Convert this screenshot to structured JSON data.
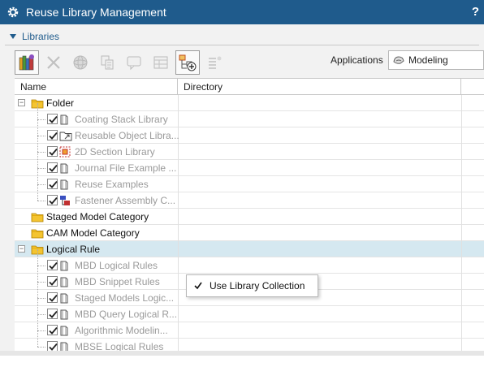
{
  "window": {
    "title": "Reuse Library Management",
    "help_label": "?"
  },
  "section": {
    "title": "Libraries"
  },
  "toolbar": {
    "buttons": [
      {
        "name": "library-books-icon",
        "state": "enabled"
      },
      {
        "name": "delete-x-icon",
        "state": "disabled"
      },
      {
        "name": "model-sphere-icon",
        "state": "disabled"
      },
      {
        "name": "copy-documents-icon",
        "state": "disabled"
      },
      {
        "name": "chat-bubble-icon",
        "state": "disabled"
      },
      {
        "name": "window-layout-icon",
        "state": "disabled"
      },
      {
        "name": "add-collection-icon",
        "state": "enabled"
      },
      {
        "name": "settings-list-icon",
        "state": "disabled"
      }
    ]
  },
  "applications": {
    "label": "Applications",
    "selected": "Modeling"
  },
  "table": {
    "columns": [
      "Name",
      "Directory"
    ]
  },
  "rows": [
    {
      "label": "Folder",
      "level": 0,
      "kind": "folder",
      "expanded": true,
      "checked": false
    },
    {
      "label": "Coating Stack Library",
      "level": 1,
      "kind": "book",
      "checked": true
    },
    {
      "label": "Reusable Object Libra...",
      "level": 1,
      "kind": "folder-arrow",
      "checked": true
    },
    {
      "label": "2D Section Library",
      "level": 1,
      "kind": "section",
      "checked": true
    },
    {
      "label": "Journal File Example ...",
      "level": 1,
      "kind": "book",
      "checked": true
    },
    {
      "label": "Reuse Examples",
      "level": 1,
      "kind": "book",
      "checked": true
    },
    {
      "label": "Fastener Assembly C...",
      "level": 1,
      "kind": "fastener",
      "checked": true
    },
    {
      "label": "Staged Model Category",
      "level": 0,
      "kind": "folder",
      "checked": false
    },
    {
      "label": "CAM Model Category",
      "level": 0,
      "kind": "folder",
      "checked": false
    },
    {
      "label": "Logical Rule",
      "level": 0,
      "kind": "folder",
      "expanded": true,
      "checked": false,
      "selected": true
    },
    {
      "label": "MBD Logical Rules",
      "level": 1,
      "kind": "book",
      "checked": true
    },
    {
      "label": "MBD Snippet Rules",
      "level": 1,
      "kind": "book",
      "checked": true
    },
    {
      "label": "Staged Models Logic...",
      "level": 1,
      "kind": "book",
      "checked": true
    },
    {
      "label": "MBD Query Logical R...",
      "level": 1,
      "kind": "book",
      "checked": true
    },
    {
      "label": "Algorithmic Modelin...",
      "level": 1,
      "kind": "book",
      "checked": true
    },
    {
      "label": "MBSE Logical Rules",
      "level": 1,
      "kind": "book",
      "checked": true
    }
  ],
  "context_menu": {
    "items": [
      {
        "label": "Use Library Collection",
        "checked": true
      }
    ]
  },
  "colors": {
    "titlebar": "#1f5b8c",
    "selection": "#d5e8f0",
    "folder": "#f4c430"
  }
}
